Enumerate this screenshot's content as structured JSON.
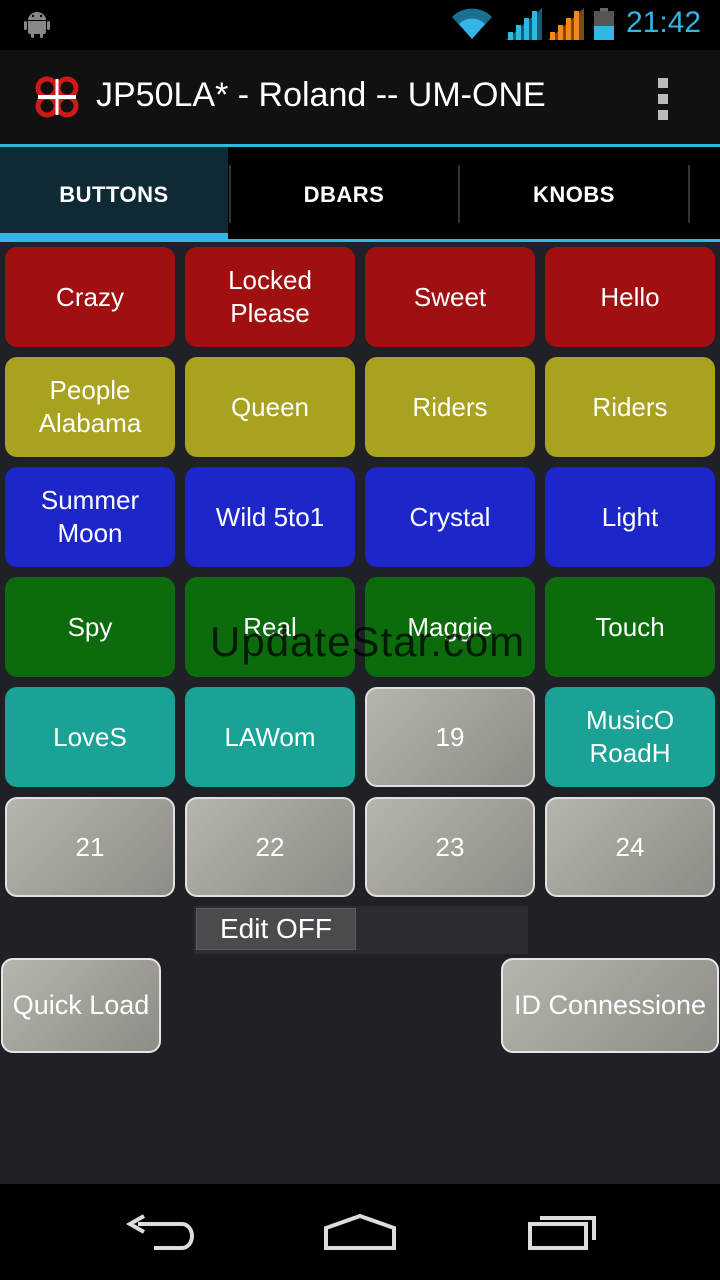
{
  "status_bar": {
    "time": "21:42",
    "icons": [
      "android-icon",
      "wifi-icon",
      "signal-icon",
      "signal-icon",
      "battery-icon"
    ],
    "accent_color": "#33b5e5"
  },
  "action_bar": {
    "title": "JP50LA* - Roland -- UM-ONE",
    "logo_icon": "app-logo-icon",
    "overflow_icon": "overflow-menu-icon"
  },
  "tabs": [
    {
      "label": "BUTTONS",
      "selected": true
    },
    {
      "label": "DBARS",
      "selected": false
    },
    {
      "label": "KNOBS",
      "selected": false
    }
  ],
  "buttons": [
    {
      "label": "Crazy",
      "color": "#a01010"
    },
    {
      "label": "Locked\nPlease",
      "color": "#a01010"
    },
    {
      "label": "Sweet",
      "color": "#a01010"
    },
    {
      "label": "Hello",
      "color": "#a01010"
    },
    {
      "label": "People\nAlabama",
      "color": "#a9a220"
    },
    {
      "label": "Queen",
      "color": "#a9a220"
    },
    {
      "label": "Riders",
      "color": "#a9a220"
    },
    {
      "label": "Riders",
      "color": "#a9a220"
    },
    {
      "label": "Summer\nMoon",
      "color": "#1c26c9"
    },
    {
      "label": "Wild 5to1",
      "color": "#1c26c9"
    },
    {
      "label": "Crystal",
      "color": "#1c26c9"
    },
    {
      "label": "Light",
      "color": "#1c26c9"
    },
    {
      "label": "Spy",
      "color": "#0c6b0c"
    },
    {
      "label": "Real",
      "color": "#0c6b0c"
    },
    {
      "label": "Maggie",
      "color": "#0c6b0c"
    },
    {
      "label": "Touch",
      "color": "#0c6b0c"
    },
    {
      "label": "LoveS",
      "color": "#1aa296"
    },
    {
      "label": "LAWom",
      "color": "#1aa296"
    },
    {
      "label": "19",
      "color": "#a3a09a"
    },
    {
      "label": "MusicO\nRoadH",
      "color": "#1aa296"
    },
    {
      "label": "21",
      "color": "#a3a09a"
    },
    {
      "label": "22",
      "color": "#a3a09a"
    },
    {
      "label": "23",
      "color": "#a3a09a"
    },
    {
      "label": "24",
      "color": "#a3a09a"
    }
  ],
  "watermark": "UpdateStar.com",
  "edit_toggle": "Edit OFF",
  "quick_load": "Quick Load",
  "id_connection": "ID Connessione",
  "nav_bar": [
    "back-icon",
    "home-icon",
    "recents-icon"
  ]
}
